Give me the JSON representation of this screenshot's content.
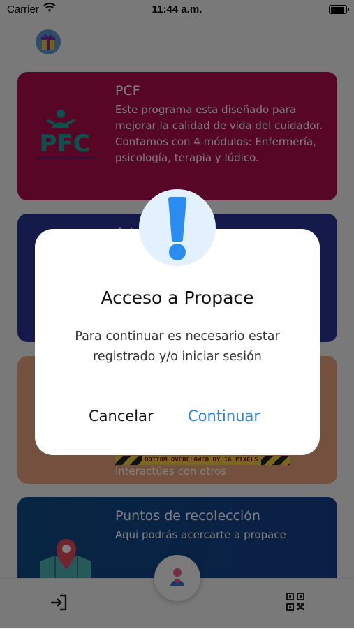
{
  "status_bar": {
    "carrier": "Carrier",
    "time": "11:44 a.m."
  },
  "cards": [
    {
      "title": "PCF",
      "description": "Este programa esta diseñado para mejorar la calidad de vida del cuidador. Contamos con 4 módulos: Enfermería, psicología, terapia y lúdico.",
      "logo_text": "PFC",
      "color": "#b10d4d"
    },
    {
      "title": "Art",
      "color": "#2b3596"
    },
    {
      "overflow_banner": "BOTTOM OVERFLOWED BY 16 PIXELS",
      "subtext": "interactúes con otros",
      "color": "#e9a27e"
    },
    {
      "title": "Puntos de recolección",
      "description": "Aqui podrás acercarte a propace",
      "color": "#0e4d86"
    }
  ],
  "dialog": {
    "title": "Acceso a Propace",
    "message": "Para continuar es necesario estar registrado y/o iniciar sesión",
    "cancel_label": "Cancelar",
    "continue_label": "Continuar",
    "icon": "exclamation-icon"
  },
  "bottom_nav": {
    "left_icon": "login-icon",
    "center_icon": "propace-logo-icon",
    "right_icon": "qr-code-icon"
  },
  "colors": {
    "accent": "#2f7fe0",
    "alert_badge_bg": "#e3f0fd",
    "alert_icon": "#2b8cf0"
  }
}
